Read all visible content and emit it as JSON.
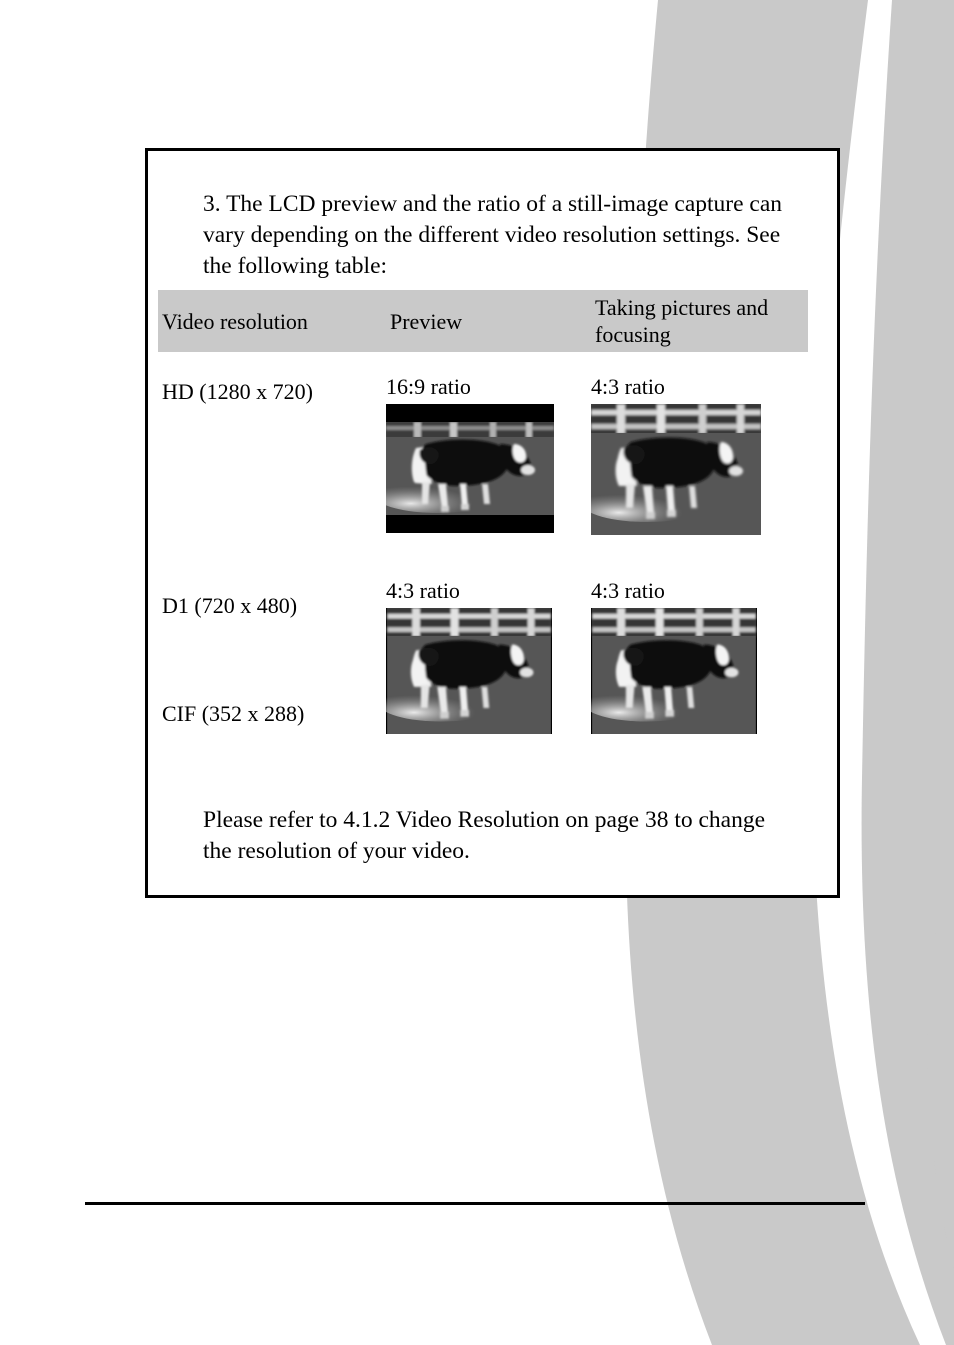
{
  "page": {
    "intro_paragraph": "3. The LCD preview and the ratio of a still-image capture can vary depending on the different video resolution settings. See the following table:",
    "closing_paragraph": "Please refer to 4.1.2 Video Resolution on page 38 to change the resolution of your video.",
    "accent_gray": "#c9c9c9",
    "border_color": "#000000",
    "background": "#ffffff"
  },
  "table": {
    "headers": {
      "resolution": "Video resolution",
      "preview": "Preview",
      "taking": "Taking pictures and focusing"
    },
    "rows": [
      {
        "resolutions": [
          "HD (1280 x 720)"
        ],
        "preview_ratio": "16:9 ratio",
        "preview_image": "cow-photo-letterboxed",
        "taking_ratio": "4:3 ratio",
        "taking_image": "cow-photo-full"
      },
      {
        "resolutions": [
          "D1 (720 x 480)",
          "CIF (352 x 288)"
        ],
        "preview_ratio": "4:3 ratio",
        "preview_image": "cow-photo-full",
        "taking_ratio": "4:3 ratio",
        "taking_image": "cow-photo-full"
      }
    ]
  }
}
